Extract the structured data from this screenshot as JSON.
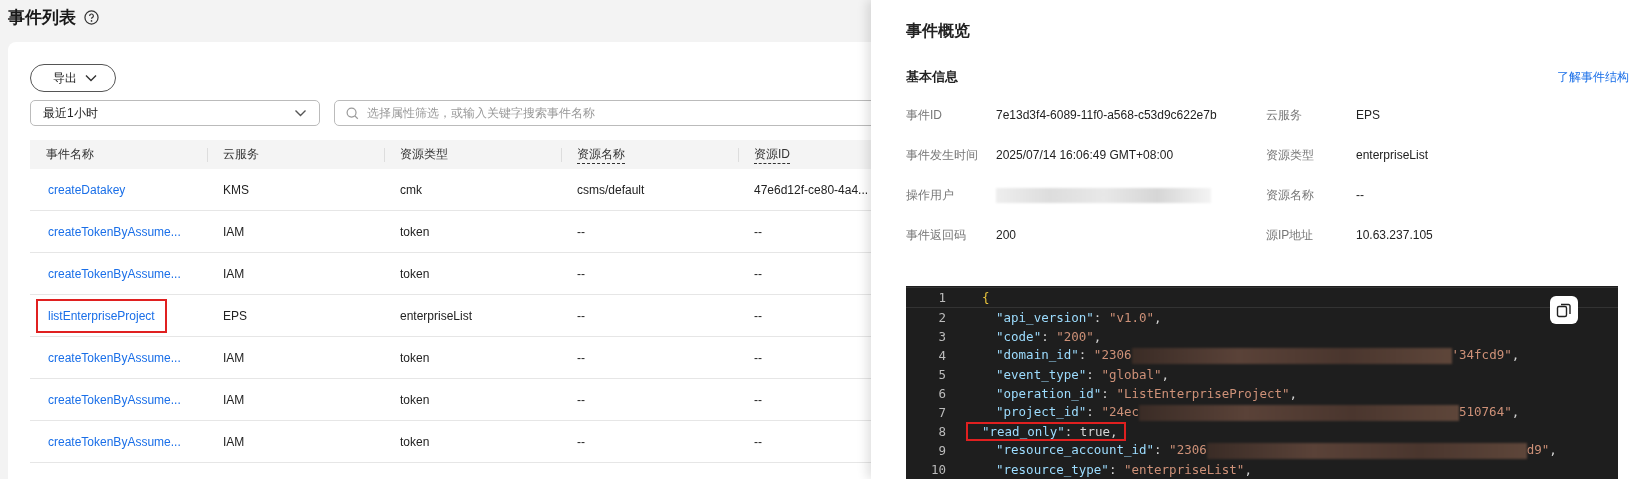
{
  "page": {
    "title": "事件列表"
  },
  "toolbar": {
    "export_button": "导出",
    "time_range": "最近1小时",
    "search": {
      "placeholder": "选择属性筛选，或输入关键字搜索事件名称"
    }
  },
  "table": {
    "columns": [
      {
        "label": "事件名称",
        "underlined": false
      },
      {
        "label": "云服务",
        "underlined": false
      },
      {
        "label": "资源类型",
        "underlined": false
      },
      {
        "label": "资源名称",
        "underlined": true
      },
      {
        "label": "资源ID",
        "underlined": true
      }
    ],
    "rows": [
      {
        "cells": [
          "createDatakey",
          "KMS",
          "cmk",
          "csms/default",
          "47e6d12f-ce80-4a4..."
        ],
        "highlighted": false
      },
      {
        "cells": [
          "createTokenByAssume...",
          "IAM",
          "token",
          "--",
          "--"
        ],
        "highlighted": false
      },
      {
        "cells": [
          "createTokenByAssume...",
          "IAM",
          "token",
          "--",
          "--"
        ],
        "highlighted": false
      },
      {
        "cells": [
          "listEnterpriseProject",
          "EPS",
          "enterpriseList",
          "--",
          "--"
        ],
        "highlighted": true
      },
      {
        "cells": [
          "createTokenByAssume...",
          "IAM",
          "token",
          "--",
          "--"
        ],
        "highlighted": false
      },
      {
        "cells": [
          "createTokenByAssume...",
          "IAM",
          "token",
          "--",
          "--"
        ],
        "highlighted": false
      },
      {
        "cells": [
          "createTokenByAssume...",
          "IAM",
          "token",
          "--",
          "--"
        ],
        "highlighted": false
      }
    ]
  },
  "drawer": {
    "title": "事件概览",
    "section_title": "基本信息",
    "link": "了解事件结构",
    "fields": [
      {
        "label": "事件ID",
        "value": "7e13d3f4-6089-11f0-a568-c53d9c622e7b",
        "redacted": false
      },
      {
        "label": "云服务",
        "value": "EPS",
        "redacted": false
      },
      {
        "label": "事件发生时间",
        "value": "2025/07/14 16:06:49 GMT+08:00",
        "redacted": false
      },
      {
        "label": "资源类型",
        "value": "enterpriseList",
        "redacted": false
      },
      {
        "label": "操作用户",
        "redacted": true
      },
      {
        "label": "资源名称",
        "value": "--",
        "redacted": false
      },
      {
        "label": "事件返回码",
        "value": "200",
        "redacted": false
      },
      {
        "label": "源IP地址",
        "value": "10.63.237.105",
        "redacted": false
      }
    ],
    "code": {
      "lines": [
        {
          "number": "1",
          "highlighted": false,
          "tokens": [
            {
              "kind": "brace",
              "text": "{"
            }
          ]
        },
        {
          "number": "2",
          "highlighted": false,
          "tokens": [
            {
              "kind": "key",
              "text": "\"api_version\""
            },
            {
              "kind": "punct",
              "text": ": "
            },
            {
              "kind": "string",
              "text": "\"v1.0\""
            },
            {
              "kind": "punct",
              "text": ","
            }
          ]
        },
        {
          "number": "3",
          "highlighted": false,
          "tokens": [
            {
              "kind": "key",
              "text": "\"code\""
            },
            {
              "kind": "punct",
              "text": ": "
            },
            {
              "kind": "string",
              "text": "\"200\""
            },
            {
              "kind": "punct",
              "text": ","
            }
          ]
        },
        {
          "number": "4",
          "highlighted": false,
          "tokens": [
            {
              "kind": "key",
              "text": "\"domain_id\""
            },
            {
              "kind": "punct",
              "text": ": "
            },
            {
              "kind": "string",
              "text": "\"2306"
            },
            {
              "kind": "redacted"
            },
            {
              "kind": "string",
              "text": "'34fcd9\""
            },
            {
              "kind": "punct",
              "text": ","
            }
          ]
        },
        {
          "number": "5",
          "highlighted": false,
          "tokens": [
            {
              "kind": "key",
              "text": "\"event_type\""
            },
            {
              "kind": "punct",
              "text": ": "
            },
            {
              "kind": "string",
              "text": "\"global\""
            },
            {
              "kind": "punct",
              "text": ","
            }
          ]
        },
        {
          "number": "6",
          "highlighted": false,
          "tokens": [
            {
              "kind": "key",
              "text": "\"operation_id\""
            },
            {
              "kind": "punct",
              "text": ": "
            },
            {
              "kind": "string",
              "text": "\"ListEnterpriseProject\""
            },
            {
              "kind": "punct",
              "text": ","
            }
          ]
        },
        {
          "number": "7",
          "highlighted": false,
          "tokens": [
            {
              "kind": "key",
              "text": "\"project_id\""
            },
            {
              "kind": "punct",
              "text": ": "
            },
            {
              "kind": "string",
              "text": "\"24ec"
            },
            {
              "kind": "redacted"
            },
            {
              "kind": "string",
              "text": "510764\""
            },
            {
              "kind": "punct",
              "text": ","
            }
          ]
        },
        {
          "number": "8",
          "highlighted": true,
          "tokens": [
            {
              "kind": "key",
              "text": "\"read_only\""
            },
            {
              "kind": "punct",
              "text": ": "
            },
            {
              "kind": "bool",
              "text": "true"
            },
            {
              "kind": "punct",
              "text": ","
            }
          ]
        },
        {
          "number": "9",
          "highlighted": false,
          "tokens": [
            {
              "kind": "key",
              "text": "\"resource_account_id\""
            },
            {
              "kind": "punct",
              "text": ": "
            },
            {
              "kind": "string",
              "text": "\"2306"
            },
            {
              "kind": "redacted"
            },
            {
              "kind": "string",
              "text": "d9\""
            },
            {
              "kind": "punct",
              "text": ","
            }
          ]
        },
        {
          "number": "10",
          "highlighted": false,
          "tokens": [
            {
              "kind": "key",
              "text": "\"resource_type\""
            },
            {
              "kind": "punct",
              "text": ": "
            },
            {
              "kind": "string",
              "text": "\"enterpriseList\""
            },
            {
              "kind": "punct",
              "text": ","
            }
          ]
        }
      ]
    }
  }
}
